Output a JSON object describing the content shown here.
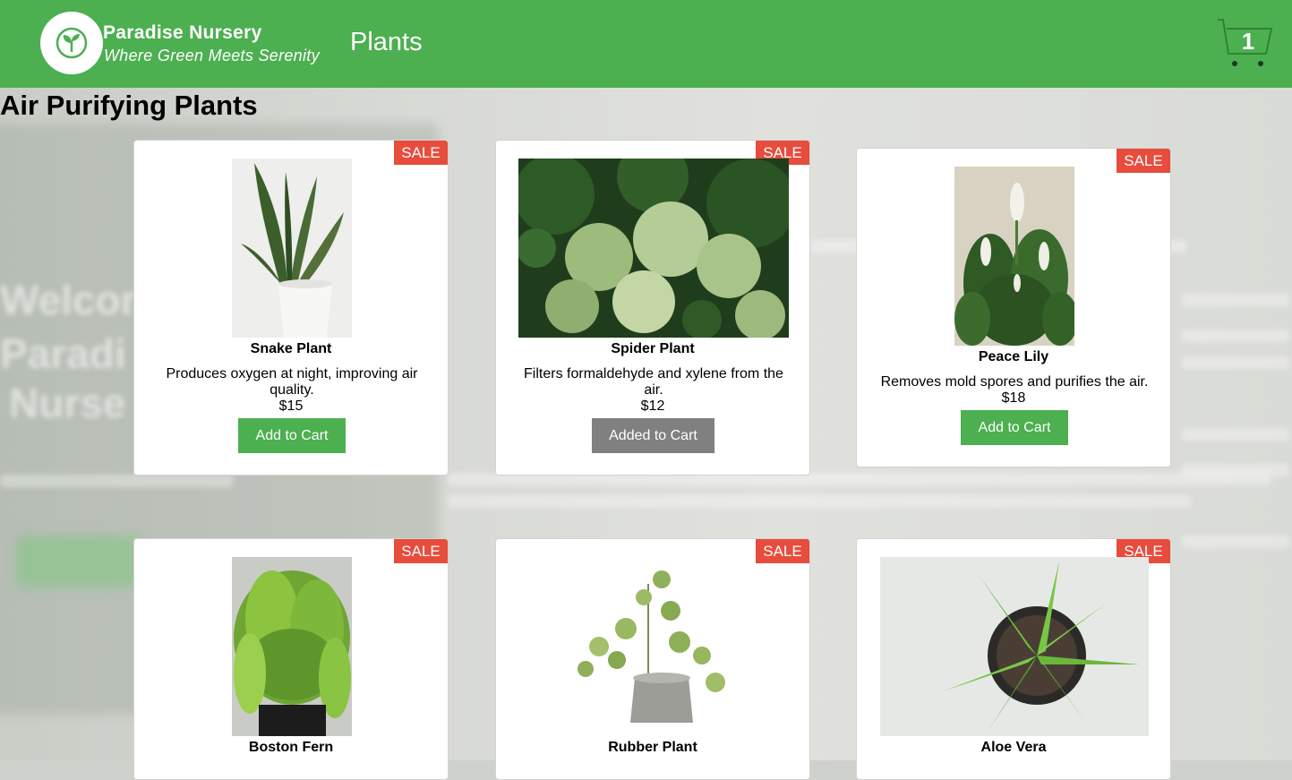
{
  "brand": {
    "name": "Paradise Nursery",
    "tagline": "Where Green Meets Serenity"
  },
  "nav": {
    "plants_link": "Plants"
  },
  "cart": {
    "count": "1"
  },
  "section": {
    "title": "Air Purifying Plants"
  },
  "plants": [
    {
      "name": "Snake Plant",
      "description": "Produces oxygen at night, improving air quality.",
      "price": "$15",
      "badge": "SALE",
      "button": "Add to Cart"
    },
    {
      "name": "Spider Plant",
      "description": "Filters formaldehyde and xylene from the air.",
      "price": "$12",
      "badge": "SALE",
      "button": "Added to Cart"
    },
    {
      "name": "Peace Lily",
      "description": "Removes mold spores and purifies the air.",
      "price": "$18",
      "badge": "SALE",
      "button": "Add to Cart"
    },
    {
      "name": "Boston Fern",
      "badge": "SALE"
    },
    {
      "name": "Rubber Plant",
      "badge": "SALE"
    },
    {
      "name": "Aloe Vera",
      "badge": "SALE"
    }
  ],
  "colors": {
    "header": "#4caf50",
    "sale": "#e74c3c",
    "button": "#4caf50",
    "button_added": "#808080"
  }
}
